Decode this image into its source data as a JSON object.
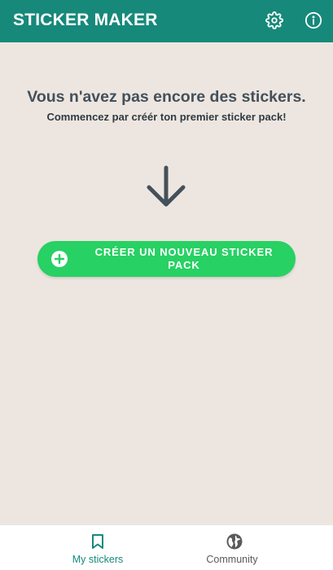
{
  "app_bar": {
    "title": "STICKER MAKER",
    "color": "#16897a",
    "settings_icon": "gear-icon",
    "info_icon": "info-icon"
  },
  "empty_state": {
    "title": "Vous n'avez pas encore des stickers.",
    "subtitle": "Commencez par créér ton premier sticker pack!",
    "arrow_icon": "arrow-down-icon"
  },
  "create_button": {
    "label": "CRÉER UN NOUVEAU STICKER PACK",
    "icon": "plus-circle-icon",
    "color": "#27d163"
  },
  "bottom_nav": {
    "items": [
      {
        "label": "My stickers",
        "icon": "bookmark-icon",
        "active": true
      },
      {
        "label": "Community",
        "icon": "globe-icon",
        "active": false
      }
    ],
    "active_color": "#16897a"
  }
}
